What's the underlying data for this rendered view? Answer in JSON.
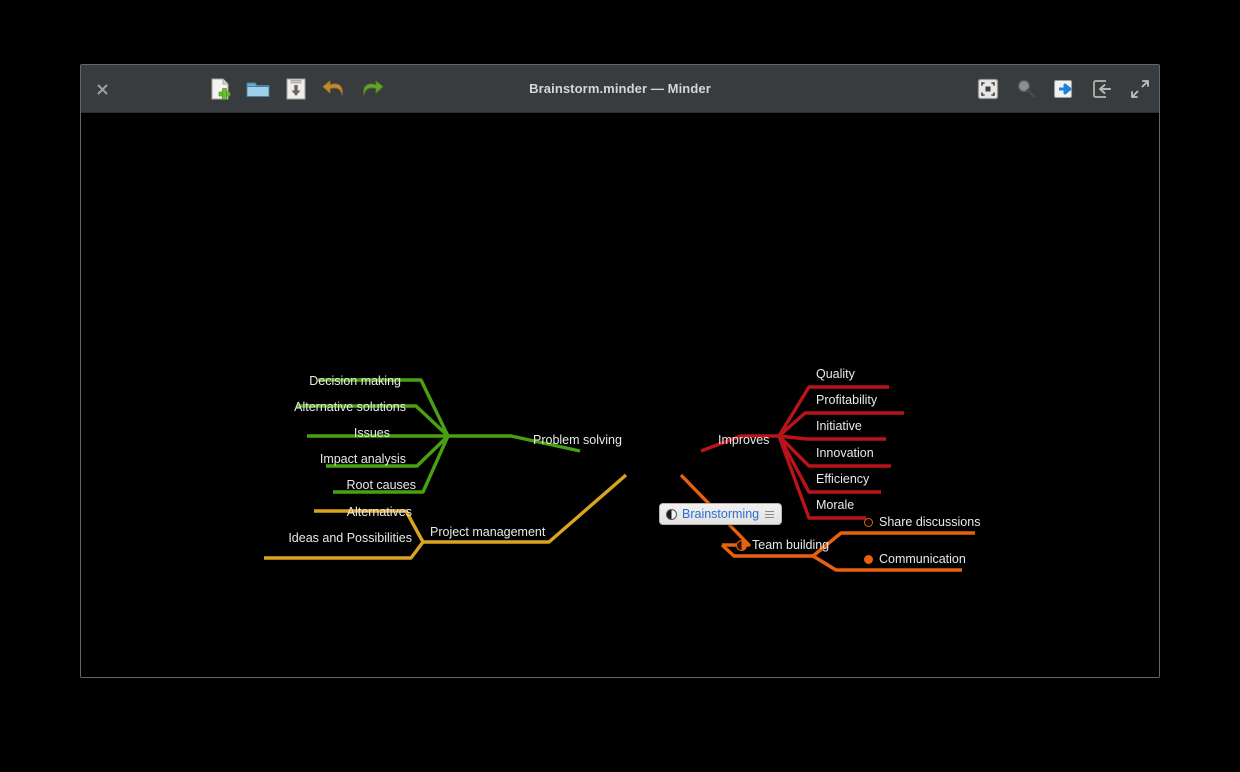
{
  "window": {
    "title": "Brainstorm.minder — Minder",
    "close_label": "×"
  },
  "toolbar": {
    "left_buttons": [
      {
        "name": "new-document-button",
        "label": "New"
      },
      {
        "name": "open-document-button",
        "label": "Open"
      },
      {
        "name": "save-document-button",
        "label": "Save"
      },
      {
        "name": "undo-button",
        "label": "Undo"
      },
      {
        "name": "redo-button",
        "label": "Redo"
      }
    ],
    "right_buttons": [
      {
        "name": "focus-mode-button",
        "label": "Focus Mode"
      },
      {
        "name": "zoom-button",
        "label": "Zoom"
      },
      {
        "name": "export-button",
        "label": "Export"
      },
      {
        "name": "sidebar-toggle-button",
        "label": "Properties"
      },
      {
        "name": "fullscreen-button",
        "label": "Fullscreen"
      }
    ]
  },
  "mindmap": {
    "root": {
      "text": "Brainstorming",
      "fold_icon": "half-circle-fold-icon",
      "note_icon": "note-lines-icon"
    },
    "branches": [
      {
        "id": "problem-solving",
        "text": "Problem solving",
        "color": "#49a010",
        "side": "left",
        "children": [
          {
            "text": "Decision making"
          },
          {
            "text": "Alternative solutions"
          },
          {
            "text": "Issues"
          },
          {
            "text": "Impact analysis"
          },
          {
            "text": "Root causes"
          }
        ]
      },
      {
        "id": "project-management",
        "text": "Project management",
        "color": "#d9a520",
        "side": "left",
        "children": [
          {
            "text": "Alternatives"
          },
          {
            "text": "Ideas and Possibilities"
          }
        ]
      },
      {
        "id": "improves",
        "text": "Improves",
        "color": "#b8141a",
        "side": "right",
        "children": [
          {
            "text": "Quality"
          },
          {
            "text": "Profitability"
          },
          {
            "text": "Initiative"
          },
          {
            "text": "Innovation"
          },
          {
            "text": "Efficiency"
          },
          {
            "text": "Morale"
          }
        ]
      },
      {
        "id": "team-building",
        "text": "Team building",
        "color": "#e8610d",
        "side": "right",
        "fold_icon": "half-circle-fold-icon",
        "children": [
          {
            "text": "Share discussions",
            "marker": "hollow-circle-icon"
          },
          {
            "text": "Communication",
            "marker": "filled-circle-icon"
          }
        ]
      }
    ]
  },
  "colors": {
    "canvas_background": "#000000",
    "header_background": "#383c3f",
    "node_text": "#e8eaea",
    "root_text": "#2a6fd4",
    "green_branch": "#49a010",
    "gold_branch": "#d9a520",
    "red_branch": "#b8141a",
    "orange_branch": "#e8610d"
  }
}
